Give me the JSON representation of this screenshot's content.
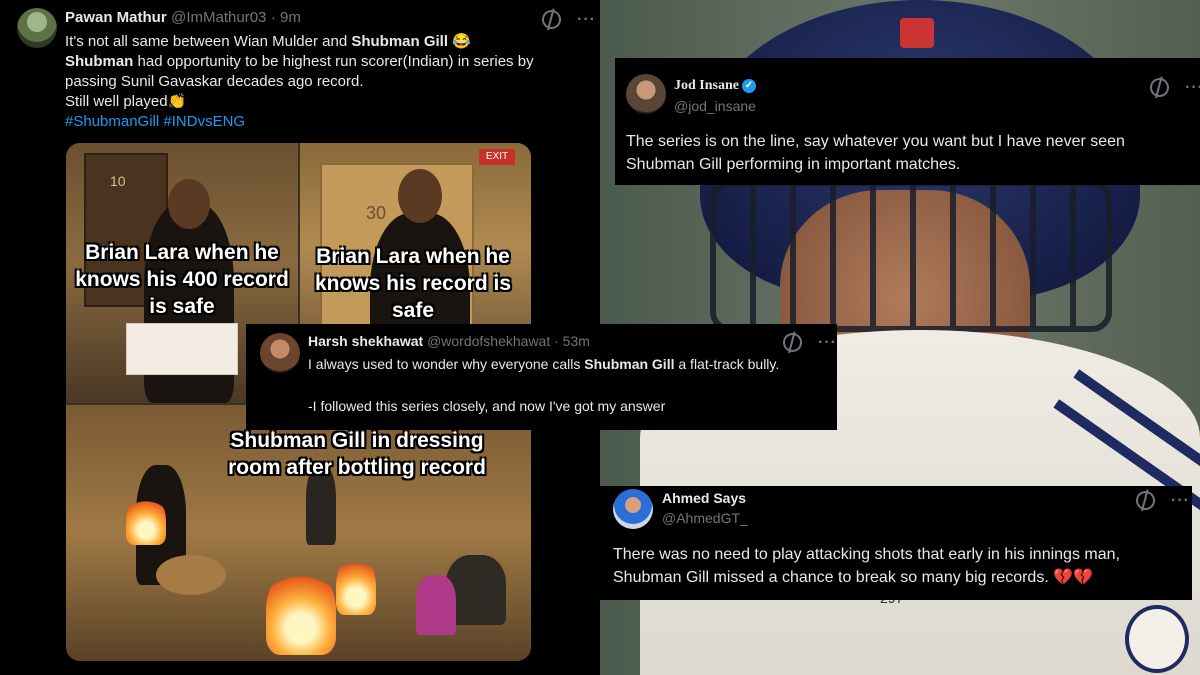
{
  "tweet_main": {
    "name": "Pawan Mathur",
    "handle": "@ImMathur03",
    "time": "· 9m",
    "line1": "It's not all same between Wian Mulder and ",
    "line1_bold": "Shubman Gill",
    "line1_emoji": " 😂",
    "line2_bold": "Shubman",
    "line2": " had opportunity to be highest run scorer(Indian) in series by passing Sunil Gavaskar decades ago record.",
    "line3": "Still well played👏",
    "hashtag1": "#ShubmanGill",
    "hashtag2": "#INDvsENG",
    "meme": {
      "caption_left": "Brian Lara when he knows his 400 record is safe",
      "caption_right": "Brian Lara when he knows his record is safe",
      "caption_bottom": "Shubman Gill in dressing room after bottling record",
      "exit_sign": "EXIT",
      "door_number_left": "10",
      "door_number_right": "30"
    }
  },
  "tweet_jod": {
    "name": "Jod Insane",
    "handle": "@jod_insane",
    "text": "The series is on the line, say whatever you want but I have never seen Shubman Gill performing in important matches."
  },
  "tweet_harsh": {
    "name": "Harsh shekhawat",
    "handle": "@wordofshekhawat",
    "time": "· 53m",
    "text_pre": "I always used to wonder why everyone calls ",
    "text_bold": "Shubman Gill",
    "text_post": " a flat-track bully.",
    "text2": "-I followed this series closely, and now I've got my answer"
  },
  "tweet_ahmed": {
    "name": "Ahmed Says",
    "handle": "@AhmedGT_",
    "text": "There was no need to play attacking shots that early in his innings man, Shubman Gill missed a chance to break so many big records.",
    "emoji": " 💔💔"
  },
  "background": {
    "shirt_number": "297"
  },
  "icons": {
    "grok": "grok-icon",
    "more": "more-icon",
    "verified": "verified-icon"
  },
  "colors": {
    "link": "#1d9bf0",
    "muted": "#71767b",
    "text": "#e7e9ea",
    "background": "#000000"
  }
}
